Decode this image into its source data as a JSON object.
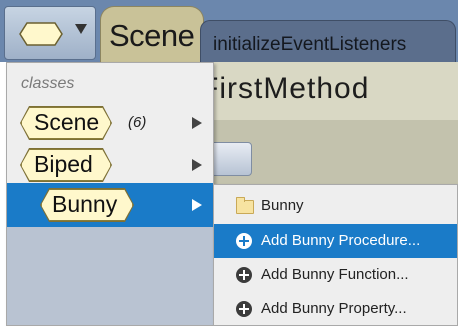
{
  "tabs": {
    "scene_label": "Scene",
    "method_label": "initializeEventListeners"
  },
  "editor": {
    "method_title": "FirstMethod"
  },
  "class_menu": {
    "header": "classes",
    "items": [
      {
        "label": "Scene",
        "count": "(6)"
      },
      {
        "label": "Biped"
      },
      {
        "label": "Bunny",
        "selected": true
      }
    ]
  },
  "submenu": {
    "items": [
      {
        "icon": "folder-icon",
        "label": "Bunny"
      },
      {
        "icon": "plus-circle-icon",
        "label": "Add Bunny Procedure...",
        "selected": true
      },
      {
        "icon": "plus-circle-icon",
        "label": "Add Bunny Function..."
      },
      {
        "icon": "plus-circle-icon",
        "label": "Add Bunny Property..."
      }
    ]
  },
  "colors": {
    "selection": "#1a7bc8",
    "type_chip_fill": "#fff8cc",
    "scene_tab": "#c9c298",
    "tab_bar": "#6b87ad"
  }
}
